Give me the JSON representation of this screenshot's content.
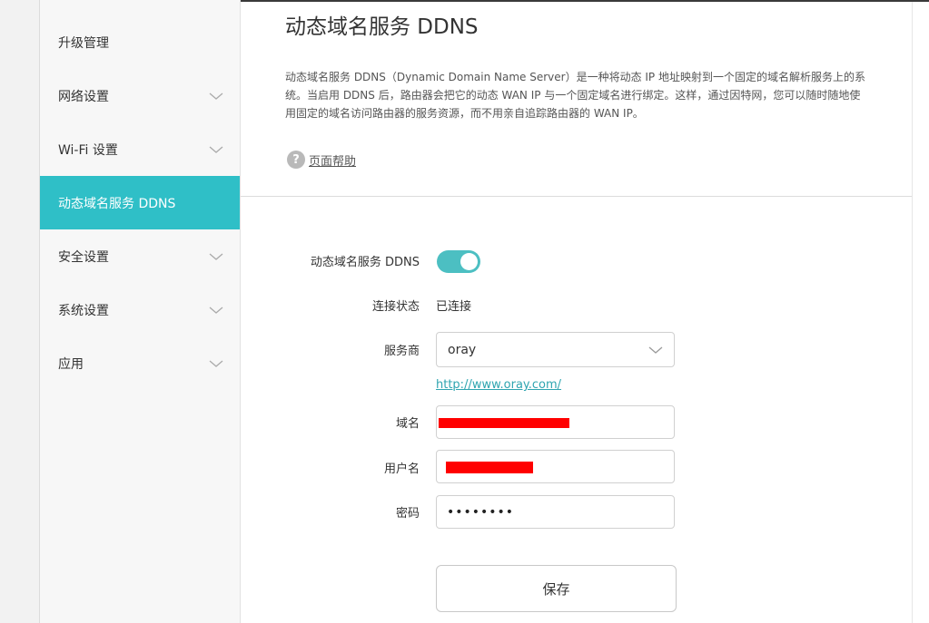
{
  "sidebar": {
    "items": [
      {
        "label": "升级管理",
        "has_chevron": false
      },
      {
        "label": "网络设置",
        "has_chevron": true
      },
      {
        "label": "Wi-Fi 设置",
        "has_chevron": true
      },
      {
        "label": "动态域名服务 DDNS",
        "has_chevron": false,
        "active": true
      },
      {
        "label": "安全设置",
        "has_chevron": true
      },
      {
        "label": "系统设置",
        "has_chevron": true
      },
      {
        "label": "应用",
        "has_chevron": true
      }
    ]
  },
  "main": {
    "title": "动态域名服务 DDNS",
    "description": "动态域名服务 DDNS（Dynamic Domain Name Server）是一种将动态 IP 地址映射到一个固定的域名解析服务上的系统。当启用 DDNS 后，路由器会把它的动态 WAN IP 与一个固定域名进行绑定。这样，通过因特网，您可以随时随地使用固定的域名访问路由器的服务资源，而不用亲自追踪路由器的 WAN IP。",
    "help_icon_glyph": "?",
    "help_label": "页面帮助"
  },
  "form": {
    "ddns_label": "动态域名服务 DDNS",
    "ddns_enabled": true,
    "status_label": "连接状态",
    "status_value": "已连接",
    "provider_label": "服务商",
    "provider_value": "oray",
    "provider_link": "http://www.oray.com/",
    "domain_label": "域名",
    "username_label": "用户名",
    "password_label": "密码",
    "password_value": "••••••••",
    "save_label": "保存"
  },
  "colors": {
    "accent": "#2fbfc7",
    "toggle_on": "#4cbfc2",
    "link": "#2fa5b0",
    "redaction": "#ff0000"
  }
}
